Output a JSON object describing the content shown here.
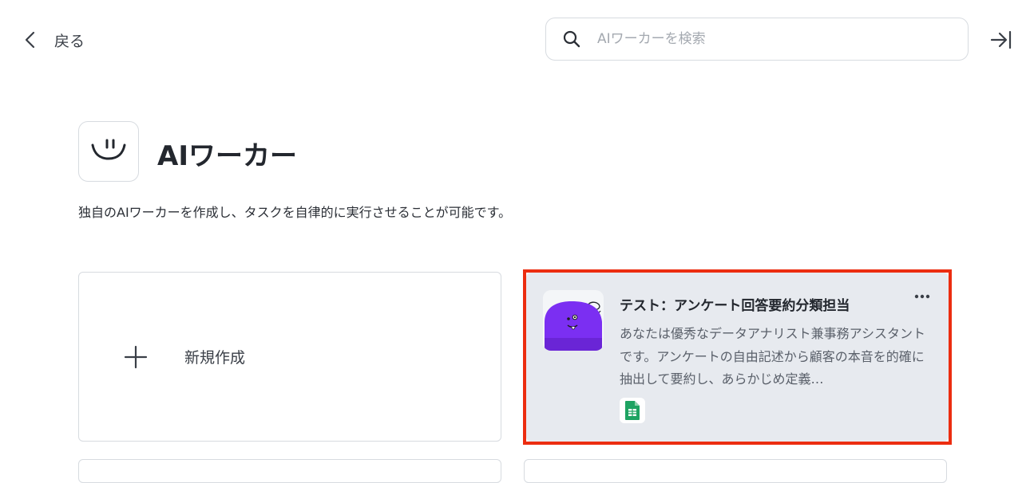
{
  "nav": {
    "back_label": "戻る",
    "back_icon": "chevron-left-icon",
    "collapse_icon": "collapse-right-icon"
  },
  "search": {
    "placeholder": "AIワーカーを検索",
    "icon": "search-icon"
  },
  "header": {
    "title": "AIワーカー",
    "description": "独自のAIワーカーを作成し、タスクを自律的に実行させることが可能です。",
    "logo_icon": "smile-logo-icon"
  },
  "cards": {
    "new": {
      "label": "新規作成",
      "icon": "plus-icon"
    },
    "workers": [
      {
        "title": "テスト：アンケート回答要約分類担当",
        "description": "あなたは優秀なデータアナリスト兼事務アシスタントです。アンケートの自由記述から顧客の本音を的確に抽出して要約し、あらかじめ定義…",
        "avatar": "purple-mascot-icon",
        "app_icon": "google-sheets-icon",
        "more_icon": "more-horizontal-icon",
        "selected": true
      }
    ]
  },
  "colors": {
    "highlight": "#ec2d10",
    "card_selected_bg": "#e7eaef",
    "mascot": "#7b2ff2",
    "sheets_green": "#1ea362"
  }
}
